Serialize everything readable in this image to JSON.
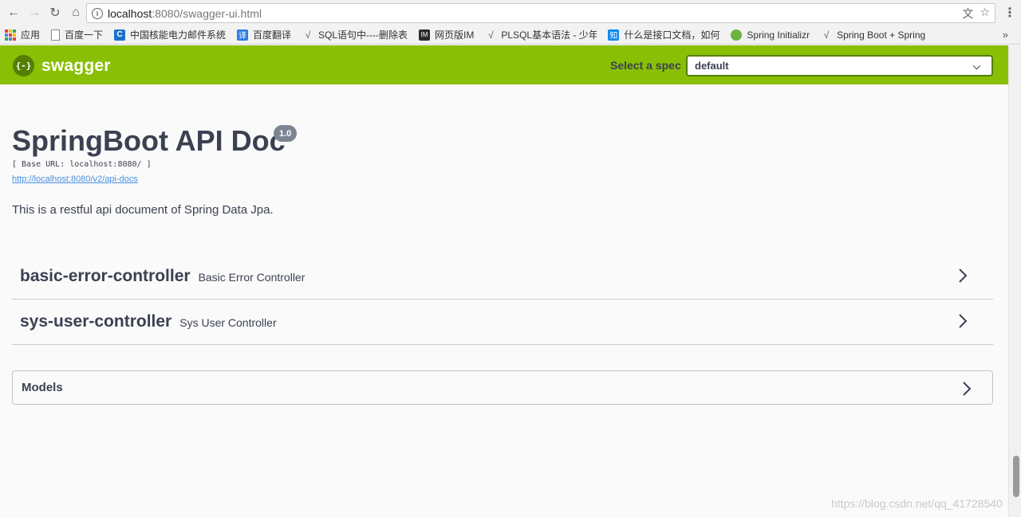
{
  "browser": {
    "url_host": "localhost",
    "url_path": ":8080/swagger-ui.html",
    "bookmarks": [
      {
        "label": "应用",
        "icon": "apps-grid-icon"
      },
      {
        "label": "百度一下",
        "icon": "page-icon"
      },
      {
        "label": "中国核能电力邮件系统",
        "icon": "c-logo-icon",
        "color": "#1a73c9"
      },
      {
        "label": "百度翻译",
        "icon": "translate-icon",
        "color": "#2f7de1"
      },
      {
        "label": "SQL语句中----删除表",
        "icon": "csdn-icon"
      },
      {
        "label": "网页版IM",
        "icon": "im-icon",
        "color": "#2b2b2b"
      },
      {
        "label": "PLSQL基本语法 - 少年",
        "icon": "csdn-icon"
      },
      {
        "label": "什么是接口文档，如何",
        "icon": "zhihu-icon",
        "color": "#0f88eb"
      },
      {
        "label": "Spring Initializr",
        "icon": "spring-icon",
        "color": "#6db33f"
      },
      {
        "label": "Spring Boot + Spring",
        "icon": "csdn-icon"
      }
    ]
  },
  "topbar": {
    "logo_mark": "{-}",
    "logo_text": "swagger",
    "spec_label": "Select a spec",
    "spec_value": "default",
    "brand_color": "#89bf04"
  },
  "info": {
    "title": "SpringBoot API Doc",
    "version": "1.0",
    "base_url": "[ Base URL: localhost:8080/ ]",
    "docs_link": "http://localhost:8080/v2/api-docs",
    "description": "This is a restful api document of Spring Data Jpa."
  },
  "controllers": [
    {
      "name": "basic-error-controller",
      "desc": "Basic Error Controller"
    },
    {
      "name": "sys-user-controller",
      "desc": "Sys User Controller"
    }
  ],
  "models": {
    "label": "Models"
  },
  "watermark": "https://blog.csdn.net/qq_41728540"
}
